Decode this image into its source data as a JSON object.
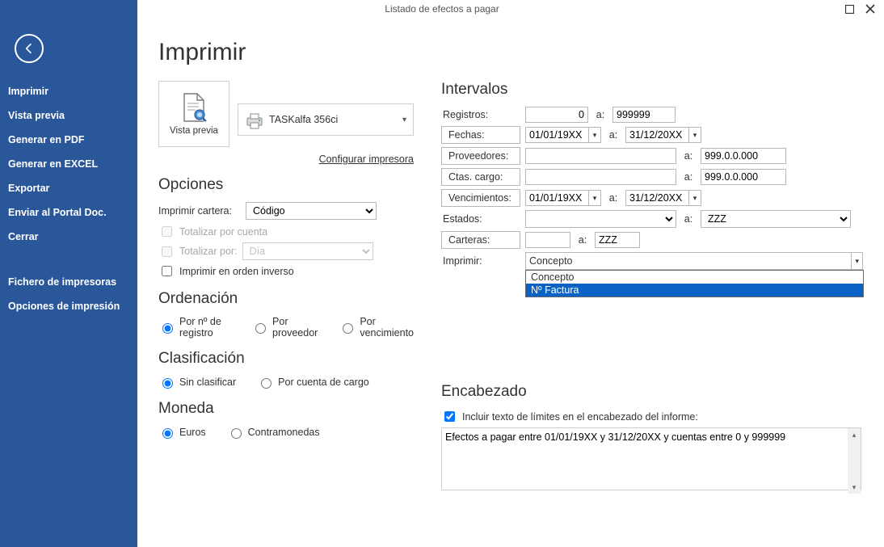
{
  "titlebar": {
    "title": "Listado de efectos a pagar"
  },
  "sidebar": {
    "items": [
      "Imprimir",
      "Vista previa",
      "Generar en PDF",
      "Generar en EXCEL",
      "Exportar",
      "Enviar al Portal Doc.",
      "Cerrar"
    ],
    "items2": [
      "Fichero de impresoras",
      "Opciones de impresión"
    ]
  },
  "page": {
    "title": "Imprimir",
    "preview_label": "Vista previa",
    "printer_name": "TASKalfa 356ci",
    "config_printer": "Configurar impresora"
  },
  "opciones": {
    "heading": "Opciones",
    "imprimir_cartera_label": "Imprimir cartera:",
    "imprimir_cartera_value": "Código",
    "totalizar_por_cuenta": "Totalizar por cuenta",
    "totalizar_por_label": "Totalizar por:",
    "totalizar_por_value": "Día",
    "imprimir_orden_inverso": "Imprimir en orden inverso"
  },
  "ordenacion": {
    "heading": "Ordenación",
    "opts": [
      "Por nº de registro",
      "Por proveedor",
      "Por vencimiento"
    ]
  },
  "clasificacion": {
    "heading": "Clasificación",
    "opts": [
      "Sin clasificar",
      "Por cuenta de cargo"
    ]
  },
  "moneda": {
    "heading": "Moneda",
    "opts": [
      "Euros",
      "Contramonedas"
    ]
  },
  "intervalos": {
    "heading": "Intervalos",
    "registros_label": "Registros:",
    "registros_from": "0",
    "registros_to": "999999",
    "fechas_label": "Fechas:",
    "fechas_from": "01/01/19XX",
    "fechas_to": "31/12/20XX",
    "proveedores_label": "Proveedores:",
    "proveedores_from": "",
    "proveedores_to": "999.0.0.000",
    "ctas_label": "Ctas. cargo:",
    "ctas_from": "",
    "ctas_to": "999.0.0.000",
    "vencimientos_label": "Vencimientos:",
    "venc_from": "01/01/19XX",
    "venc_to": "31/12/20XX",
    "estados_label": "Estados:",
    "estados_from": "",
    "estados_to": "ZZZ",
    "carteras_label": "Carteras:",
    "carteras_from": "",
    "carteras_to": "ZZZ",
    "imprimir_label": "Imprimir:",
    "imprimir_value": "Concepto",
    "imprimir_opts": [
      "Concepto",
      "Nº Factura"
    ],
    "a": "a:"
  },
  "encabezado": {
    "heading": "Encabezado",
    "check_label": "Incluir texto de límites en el encabezado del informe:",
    "text": "Efectos a pagar entre 01/01/19XX y 31/12/20XX y cuentas entre 0 y 999999"
  }
}
